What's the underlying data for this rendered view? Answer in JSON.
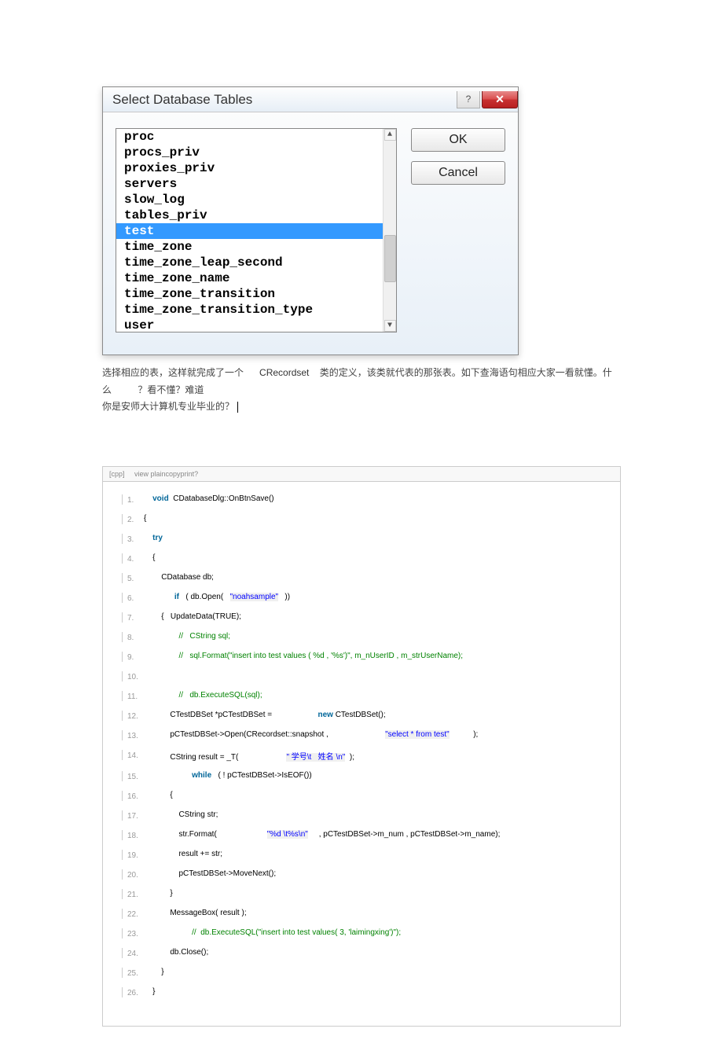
{
  "dialog": {
    "title": "Select Database Tables",
    "help_icon": "?",
    "close_icon": "✕",
    "ok_label": "OK",
    "cancel_label": "Cancel",
    "list": [
      "proc",
      "procs_priv",
      "proxies_priv",
      "servers",
      "slow_log",
      "tables_priv",
      "test",
      "time_zone",
      "time_zone_leap_second",
      "time_zone_name",
      "time_zone_transition",
      "time_zone_transition_type",
      "user"
    ],
    "selected_index": 6,
    "scroll_up": "▲",
    "scroll_down": "▼"
  },
  "description": {
    "p1_a": "选择相应的表，这样就完成了一个",
    "p1_b": "CRecordset",
    "p1_c": "类的定义，该类就代表的那张表。如下查海语句相应大家一看就懂。什么",
    "p1_d": "？看不懂？难道",
    "p2": "你是安师大计算机专业毕业的？"
  },
  "code_header": {
    "lang": "[cpp]",
    "links": "view plaincopyprint?"
  },
  "code": [
    {
      "n": "1.",
      "indent": "    ",
      "tokens": [
        {
          "t": "void",
          "c": "kw"
        },
        {
          "t": "  CDatabaseDlg::OnBtnSave()  "
        }
      ]
    },
    {
      "n": "2.",
      "indent": "",
      "tokens": [
        {
          "t": "{  "
        }
      ]
    },
    {
      "n": "3.",
      "indent": "    ",
      "tokens": [
        {
          "t": "try",
          "c": "kw"
        },
        {
          "t": "  "
        }
      ]
    },
    {
      "n": "4.",
      "indent": "    ",
      "tokens": [
        {
          "t": "{      "
        }
      ]
    },
    {
      "n": "5.",
      "indent": "        ",
      "tokens": [
        {
          "t": "CDatabase db;  "
        }
      ]
    },
    {
      "n": "6.",
      "indent": "              ",
      "tokens": [
        {
          "t": "if",
          "c": "kw"
        },
        {
          "t": "   ( db.Open(   "
        },
        {
          "t": "\"noahsample\"",
          "c": "str"
        },
        {
          "t": "   ))  "
        }
      ]
    },
    {
      "n": "7.",
      "indent": "        ",
      "tokens": [
        {
          "t": "{   UpdateData(TRUE);  "
        }
      ]
    },
    {
      "n": "8.",
      "indent": "                ",
      "tokens": [
        {
          "t": "//   CString sql;",
          "c": "cmt"
        },
        {
          "t": "      "
        }
      ]
    },
    {
      "n": "9.",
      "indent": "                ",
      "tokens": [
        {
          "t": "//   sql.Format(\"insert into test values ( %d , '%s')\", m_nUserID , m_strUserName);",
          "c": "cmt"
        },
        {
          "t": "  "
        }
      ]
    },
    {
      "n": "10.",
      "indent": "",
      "tokens": [
        {
          "t": "              "
        }
      ]
    },
    {
      "n": "11.",
      "indent": "                ",
      "tokens": [
        {
          "t": "//   db.ExecuteSQL(sql);",
          "c": "cmt"
        },
        {
          "t": "  "
        }
      ]
    },
    {
      "n": "12.",
      "indent": "            ",
      "tokens": [
        {
          "t": "CTestDBSet *pCTestDBSet =                     "
        },
        {
          "t": "new",
          "c": "kw"
        },
        {
          "t": " CTestDBSet();  "
        }
      ]
    },
    {
      "n": "13.",
      "indent": "            ",
      "tokens": [
        {
          "t": "pCTestDBSet->Open(CRecordset::snapshot ,                          "
        },
        {
          "t": "\"select * from test\"",
          "c": "str"
        },
        {
          "t": "           );  "
        }
      ]
    },
    {
      "n": "14.",
      "indent": "            ",
      "tokens": [
        {
          "t": "CString result = _T(                      "
        },
        {
          "t": "\" 学号\\t   姓名 \\n\"",
          "c": "str"
        },
        {
          "t": "  );  "
        }
      ]
    },
    {
      "n": "15.",
      "indent": "                      ",
      "tokens": [
        {
          "t": "while",
          "c": "kw"
        },
        {
          "t": "   ( ! pCTestDBSet->IsEOF())  "
        }
      ]
    },
    {
      "n": "16.",
      "indent": "            ",
      "tokens": [
        {
          "t": "{  "
        }
      ]
    },
    {
      "n": "17.",
      "indent": "                ",
      "tokens": [
        {
          "t": "CString str;  "
        }
      ]
    },
    {
      "n": "18.",
      "indent": "                ",
      "tokens": [
        {
          "t": "str.Format(                       "
        },
        {
          "t": "\"%d \\t%s\\n\"",
          "c": "str"
        },
        {
          "t": "     , pCTestDBSet->m_num , pCTestDBSet->m_name);  "
        }
      ]
    },
    {
      "n": "19.",
      "indent": "                ",
      "tokens": [
        {
          "t": "result += str;  "
        }
      ]
    },
    {
      "n": "20.",
      "indent": "                ",
      "tokens": [
        {
          "t": "pCTestDBSet->MoveNext();  "
        }
      ]
    },
    {
      "n": "21.",
      "indent": "            ",
      "tokens": [
        {
          "t": "}  "
        }
      ]
    },
    {
      "n": "22.",
      "indent": "            ",
      "tokens": [
        {
          "t": "MessageBox( result );  "
        }
      ]
    },
    {
      "n": "23.",
      "indent": "                      ",
      "tokens": [
        {
          "t": "//  db.ExecuteSQL(\"insert into test values( 3, 'laimingxing')\");",
          "c": "cmt"
        },
        {
          "t": "  "
        }
      ]
    },
    {
      "n": "24.",
      "indent": "            ",
      "tokens": [
        {
          "t": "db.Close();  "
        }
      ]
    },
    {
      "n": "25.",
      "indent": "        ",
      "tokens": [
        {
          "t": "}  "
        }
      ]
    },
    {
      "n": "26.",
      "indent": "    ",
      "tokens": [
        {
          "t": "}  "
        }
      ]
    }
  ]
}
